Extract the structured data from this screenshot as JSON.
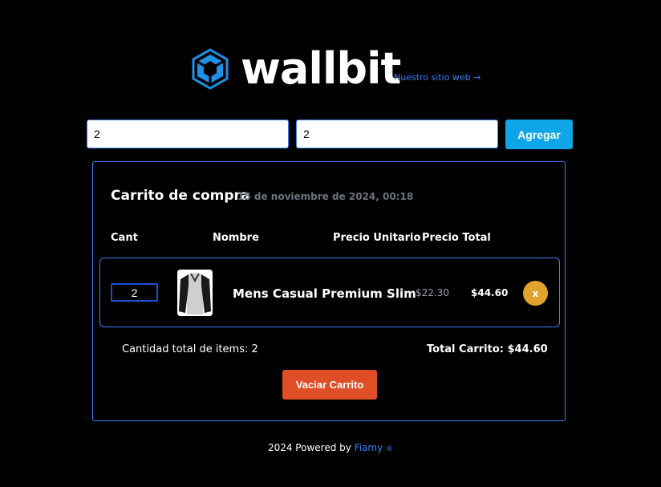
{
  "brand": {
    "name": "wallbit",
    "site_link": "Nuestro sitio web →"
  },
  "form": {
    "product_id_value": "2",
    "quantity_value": "2",
    "add_label": "Agregar"
  },
  "cart": {
    "title": "Carrito de compra",
    "date": "15 de noviembre de 2024, 00:18",
    "headers": {
      "qty": "Cant",
      "name": "Nombre",
      "unit_price": "Precio Unitario",
      "total_price": "Precio Total"
    },
    "items": [
      {
        "qty": "2",
        "name": "Mens Casual Premium Slim",
        "unit_price": "$22.30",
        "total_price": "$44.60",
        "remove_label": "x"
      }
    ],
    "item_count_text": "Cantidad total de items: 2",
    "total_text": "Total Carrito: $44.60",
    "empty_label": "Vaciar Carrito"
  },
  "footer": {
    "prefix": "2024 Powered by",
    "link": "Fiamy",
    "mark": "®"
  },
  "colors": {
    "accent_blue": "#3b82f6",
    "button_blue": "#0ea5e9",
    "remove_orange": "#e0a32e",
    "empty_red": "#e04e28"
  }
}
